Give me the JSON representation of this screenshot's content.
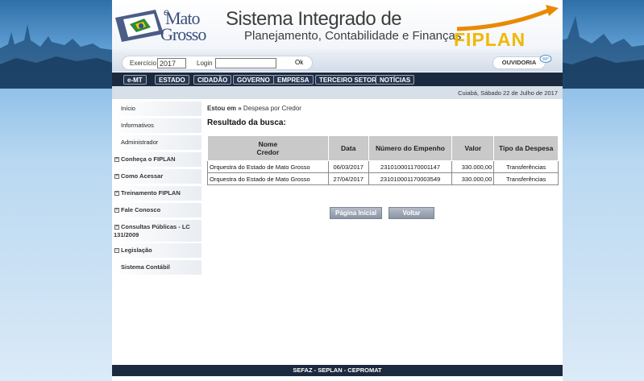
{
  "header": {
    "logo_e": "e",
    "logo_line1": "Mato",
    "logo_line2": "Grosso",
    "system_title": "Sistema Integrado de",
    "system_subtitle": "Planejamento, Contabilidade e Finanças",
    "brand": "FIPLAN"
  },
  "login_bar": {
    "exercicio_label": "Exercício",
    "exercicio_value": "2017",
    "login_label": "Login",
    "login_value": "",
    "ok_label": "Ok",
    "ouvidoria_label": "OUVIDORIA"
  },
  "nav": {
    "items": [
      "e-MT",
      "ESTADO",
      "CIDADÃO",
      "GOVERNO",
      "EMPRESA",
      "TERCEIRO SETOR",
      "NOTÍCIAS"
    ]
  },
  "date_text": "Cuiabá, Sábado 22 de Julho de 2017",
  "sidebar": {
    "items": [
      {
        "label": "Início",
        "expandable": false,
        "bold": false
      },
      {
        "label": "Informativos",
        "expandable": false,
        "bold": false
      },
      {
        "label": "Administrador",
        "expandable": false,
        "bold": false
      },
      {
        "label": "Conheça o FIPLAN",
        "expandable": true,
        "bold": true
      },
      {
        "label": "Como Acessar",
        "expandable": true,
        "bold": true
      },
      {
        "label": "Treinamento FIPLAN",
        "expandable": true,
        "bold": true
      },
      {
        "label": "Fale Conosco",
        "expandable": true,
        "bold": true
      },
      {
        "label": "Consultas Públicas - LC",
        "label2": "131/2009",
        "expandable": true,
        "bold": true
      },
      {
        "label": "Legislação",
        "expandable": true,
        "bold": true,
        "expanded": true
      },
      {
        "label": "Sistema Contábil",
        "expandable": false,
        "bold": true
      }
    ]
  },
  "main": {
    "breadcrumb_prefix": "Estou em »",
    "breadcrumb_current": "Despesa por Credor",
    "result_title": "Resultado da busca:",
    "table": {
      "headers": [
        "Nome Credor",
        "Data",
        "Número do Empenho",
        "Valor",
        "Tipo da Despesa"
      ],
      "header_name_line1": "Nome",
      "header_name_line2": "Credor",
      "rows": [
        [
          "Orquestra do Estado de Mato Grosso",
          "06/03/2017",
          "231010001170001147",
          "330.000,00",
          "Transferências"
        ],
        [
          "Orquestra do Estado de Mato Grosso",
          "27/04/2017",
          "231010001170003549",
          "330.000,00",
          "Transferências"
        ]
      ]
    },
    "btn_home": "Página Inicial",
    "btn_back": "Voltar"
  },
  "footer": "SEFAZ - SEPLAN - CEPROMAT",
  "colors": {
    "navbar": "#1c2a3f",
    "brand_yellow": "#f0b800",
    "brand_orange": "#e88a00",
    "table_header": "#c9c9c9"
  }
}
